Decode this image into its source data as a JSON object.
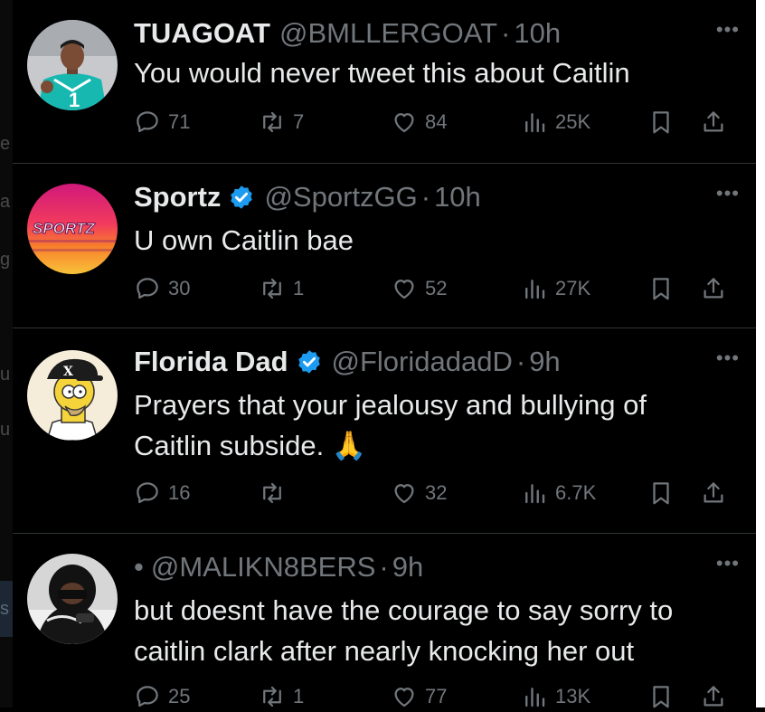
{
  "background_fragments": [
    "e",
    "a",
    "g",
    "u",
    "u",
    "s"
  ],
  "tweets": [
    {
      "name": "TUAGOAT",
      "verified": false,
      "handle": "@BMLLERGOAT",
      "time": "10h",
      "lines": [
        "You would never tweet this about Caitlin"
      ],
      "replies": "71",
      "retweets": "7",
      "likes": "84",
      "views": "25K",
      "avatar": "jersey-player"
    },
    {
      "name": "Sportz",
      "verified": true,
      "handle": "@SportzGG",
      "time": "10h",
      "lines": [
        "U own Caitlin bae"
      ],
      "replies": "30",
      "retweets": "1",
      "likes": "52",
      "views": "27K",
      "avatar": "sportz-logo",
      "avatar_text": "SPORTZ"
    },
    {
      "name": "Florida Dad",
      "verified": true,
      "handle": "@FloridadadD",
      "time": "9h",
      "lines": [
        "Prayers that your jealousy and bullying of",
        "Caitlin subside. 🙏"
      ],
      "replies": "16",
      "retweets": "",
      "likes": "32",
      "views": "6.7K",
      "avatar": "homer-cartoon",
      "avatar_text": "X"
    },
    {
      "name": "•",
      "verified": false,
      "handle": "@MALIKN8BERS",
      "time": "9h",
      "lines": [
        "but doesnt have the courage to say sorry to",
        "caitlin clark after nearly knocking her out"
      ],
      "replies": "25",
      "retweets": "1",
      "likes": "77",
      "views": "13K",
      "avatar": "hooded-person"
    }
  ],
  "icons": {
    "reply": "speech-bubble-icon",
    "retweet": "repost-arrows-icon",
    "like": "heart-icon",
    "views": "bar-chart-icon",
    "bookmark": "bookmark-icon",
    "share": "share-upload-icon",
    "more": "ellipsis-icon",
    "verified": "verified-badge-icon"
  },
  "colors": {
    "background": "#000000",
    "text": "#e7e9ea",
    "muted": "#71767b",
    "verified": "#1d9bf0",
    "divider": "#2f3336"
  }
}
